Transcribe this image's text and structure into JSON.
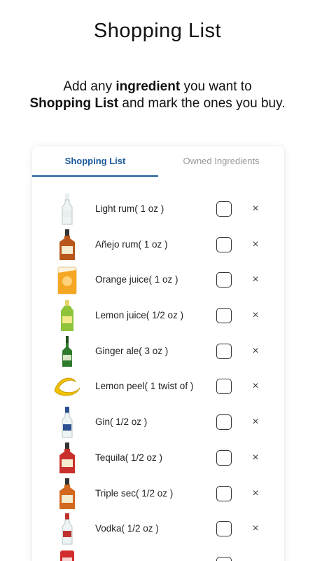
{
  "header": {
    "title": "Shopping List",
    "subtitle_part1": "Add any ",
    "subtitle_bold1": "ingredient",
    "subtitle_part2": " you want to",
    "subtitle_bold2": "Shopping List",
    "subtitle_part3": " and mark the ones you buy."
  },
  "tabs": [
    {
      "label": "Shopping List",
      "active": true
    },
    {
      "label": "Owned Ingredients",
      "active": false
    }
  ],
  "remove_symbol": "×",
  "items": [
    {
      "name": "Light rum( 1  oz )",
      "icon": "light-rum-bottle-icon",
      "color": "#e8eef0",
      "kind": "bottle-clear"
    },
    {
      "name": "Añejo rum( 1  oz )",
      "icon": "anejo-rum-bottle-icon",
      "color": "#b8561c",
      "kind": "bottle-wide"
    },
    {
      "name": "Orange juice( 1  oz )",
      "icon": "orange-juice-icon",
      "color": "#f5a623",
      "kind": "juice"
    },
    {
      "name": "Lemon juice( 1/2  oz )",
      "icon": "lemon-juice-bottle-icon",
      "color": "#8fc43a",
      "kind": "bottle-squeeze"
    },
    {
      "name": "Ginger ale( 3  oz )",
      "icon": "ginger-ale-bottle-icon",
      "color": "#2f7a2c",
      "kind": "bottle-green"
    },
    {
      "name": "Lemon peel( 1 twist of )",
      "icon": "lemon-peel-icon",
      "color": "#f2c200",
      "kind": "peel"
    },
    {
      "name": "Gin( 1/2  oz )",
      "icon": "gin-bottle-icon",
      "color": "#2e4f8f",
      "kind": "bottle-clear"
    },
    {
      "name": "Tequila( 1/2  oz )",
      "icon": "tequila-bottle-icon",
      "color": "#c9302c",
      "kind": "bottle-wide"
    },
    {
      "name": "Triple sec( 1/2  oz )",
      "icon": "triple-sec-bottle-icon",
      "color": "#d2691e",
      "kind": "bottle-wide"
    },
    {
      "name": "Vodka( 1/2  oz )",
      "icon": "vodka-bottle-icon",
      "color": "#c0312d",
      "kind": "bottle-clear"
    },
    {
      "name": "",
      "icon": "red-can-icon",
      "color": "#d22c2c",
      "kind": "can"
    }
  ]
}
